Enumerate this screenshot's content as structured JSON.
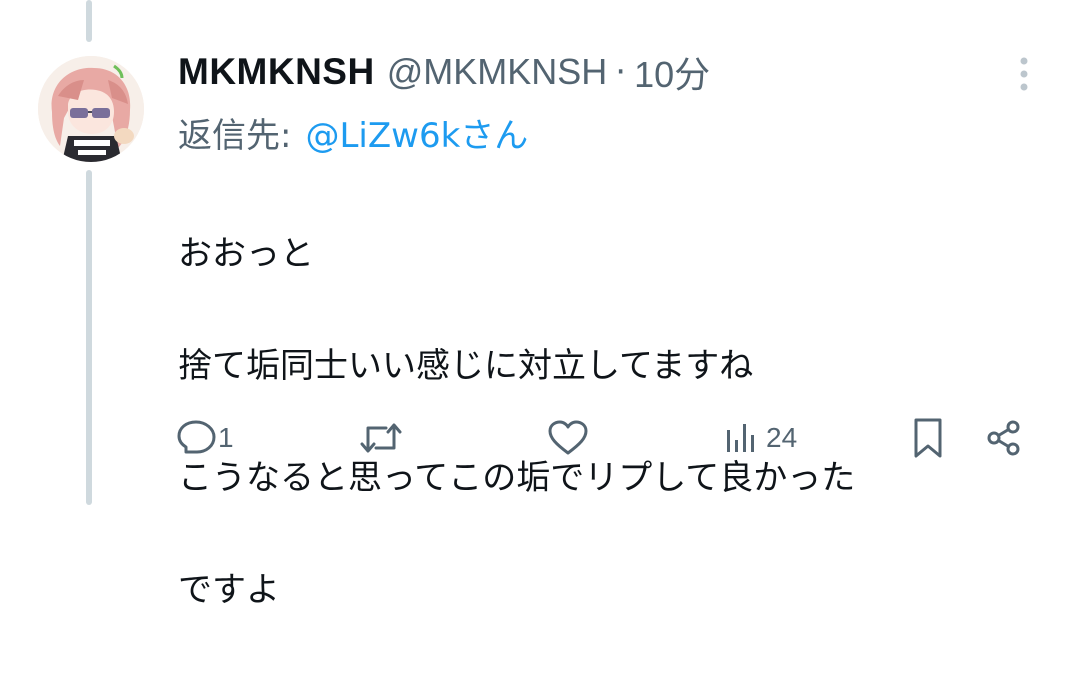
{
  "tweet": {
    "display_name": "MKMKNSH",
    "handle": "@MKMKNSH",
    "separator": "·",
    "time": "10分",
    "reply_label": "返信先:",
    "reply_target": "@LiZw6kさん",
    "text_lines": [
      "おおっと",
      "捨て垢同士いい感じに対立してますね",
      "こうなると思ってこの垢でリプして良かった",
      "ですよ"
    ]
  },
  "actions": {
    "reply_icon": "reply-bubble-icon",
    "reply_count": "1",
    "retweet_icon": "retweet-icon",
    "like_icon": "heart-icon",
    "views_icon": "bar-chart-icon",
    "views_count": "24",
    "bookmark_icon": "bookmark-icon",
    "share_icon": "share-icon"
  },
  "menu": {
    "more_icon": "vertical-dots-icon"
  },
  "colors": {
    "text_primary": "#0f1419",
    "text_secondary": "#536471",
    "link_blue": "#1d9bf0",
    "thread_line": "#cfd9de",
    "avatar_hair_pink": "#e8a9a4"
  }
}
